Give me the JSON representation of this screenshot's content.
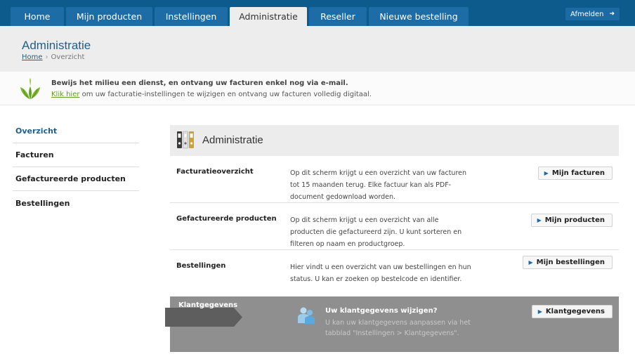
{
  "nav": {
    "tabs": [
      {
        "label": "Home",
        "active": false
      },
      {
        "label": "Mijn producten",
        "active": false
      },
      {
        "label": "Instellingen",
        "active": false
      },
      {
        "label": "Administratie",
        "active": true
      },
      {
        "label": "Reseller",
        "active": false
      },
      {
        "label": "Nieuwe bestelling",
        "active": false
      }
    ],
    "logout_label": "Afmelden"
  },
  "header": {
    "title": "Administratie",
    "breadcrumb": {
      "home": "Home",
      "current": "Overzicht"
    }
  },
  "eco_banner": {
    "headline": "Bewijs het milieu een dienst, en ontvang uw facturen enkel nog via e-mail.",
    "link": "Klik hier",
    "rest": "om uw facturatie-instellingen te wijzigen en ontvang uw facturen volledig digitaal."
  },
  "sidebar": {
    "items": [
      {
        "label": "Overzicht",
        "active": true
      },
      {
        "label": "Facturen",
        "active": false
      },
      {
        "label": "Gefactureerde producten",
        "active": false
      },
      {
        "label": "Bestellingen",
        "active": false
      }
    ]
  },
  "panel": {
    "title": "Administratie",
    "rows": [
      {
        "title": "Facturatieoverzicht",
        "desc": "Op dit scherm krijgt u een overzicht van uw facturen tot 15 maanden terug. Elke factuur kan als PDF-document gedownload worden.",
        "button": "Mijn facturen"
      },
      {
        "title": "Gefactureerde producten",
        "desc": "Op dit scherm krijgt u een overzicht van alle producten die gefactureerd zijn. U kunt sorteren en filteren op naam en productgroep.",
        "button": "Mijn producten"
      },
      {
        "title": "Bestellingen",
        "desc": "Hier vindt u een overzicht van uw bestellingen en hun status. U kan er zoeken op bestelcode en identifier.",
        "button": "Mijn bestellingen"
      }
    ],
    "klant": {
      "tag": "Klantgegevens",
      "title": "Uw klantgegevens wijzigen?",
      "desc": "U kan uw klantgegevens aanpassen via het tabblad \"Instellingen > Klantgegevens\".",
      "button": "Klantgegevens"
    }
  },
  "colors": {
    "nav_bg": "#0d5a8c",
    "tab_bg": "#1d6ca6",
    "accent_blue": "#1f5f8d",
    "eco_green": "#6a9a23",
    "klant_bg": "#8f8f8f"
  }
}
